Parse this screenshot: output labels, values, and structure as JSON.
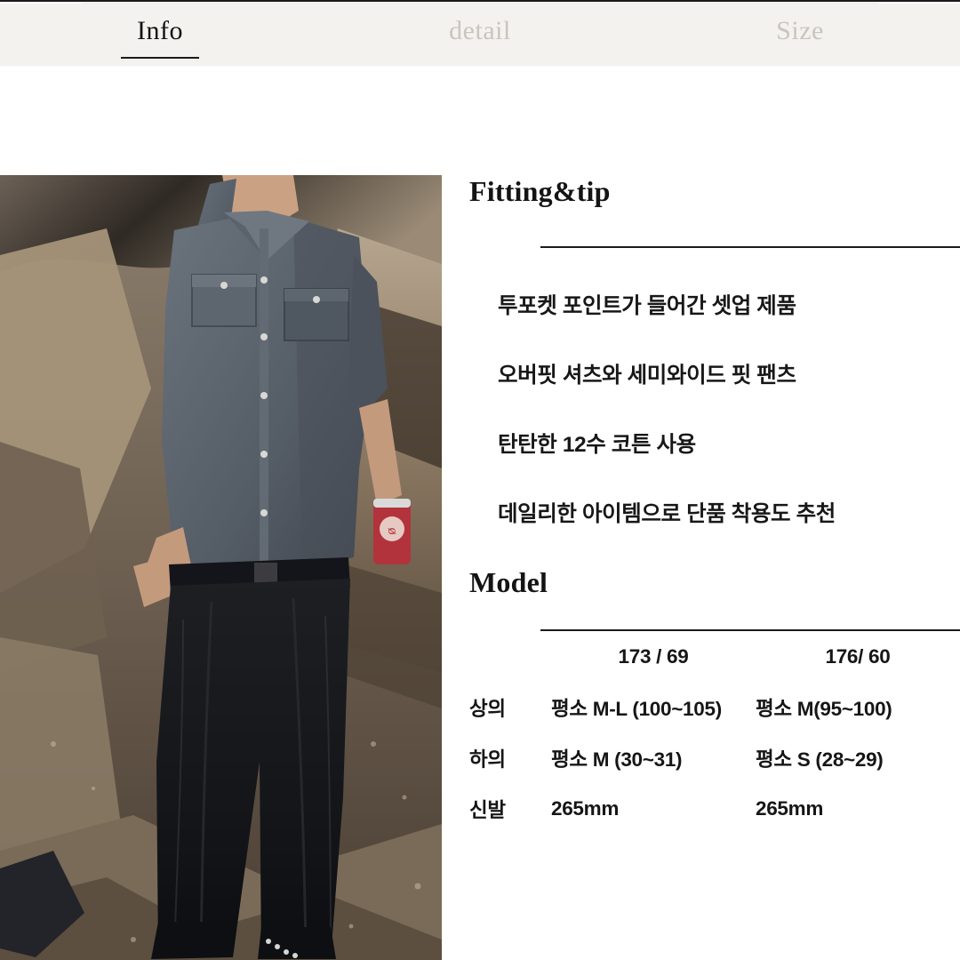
{
  "tabs": [
    {
      "label": "Info",
      "active": true
    },
    {
      "label": "detail",
      "active": false
    },
    {
      "label": "Size",
      "active": false
    }
  ],
  "fitting": {
    "heading": "Fitting&tip",
    "lines": [
      "투포켓 포인트가 들어간 셋업 제품",
      "오버핏 셔츠와 세미와이드 핏 팬츠",
      "탄탄한 12수 코튼 사용",
      "데일리한 아이템으로 단품 착용도 추천"
    ]
  },
  "model": {
    "heading": "Model",
    "columns": [
      "173 / 69",
      "176/ 60"
    ],
    "rows": [
      {
        "label": "상의",
        "a": "평소 M-L (100~105)",
        "b": "평소 M(95~100)"
      },
      {
        "label": "하의",
        "a": "평소 M (30~31)",
        "b": "평소 S (28~29)"
      },
      {
        "label": "신발",
        "a": "265mm",
        "b": "265mm"
      }
    ]
  },
  "photo": {
    "alt": "model-photo-outdoor-rocks",
    "colors": {
      "rock_dark": "#3a3027",
      "rock_mid": "#8e7d6b",
      "rock_light": "#b9a791",
      "shirt": "#59616b",
      "pants": "#15161a",
      "can": "#b2333c"
    }
  }
}
